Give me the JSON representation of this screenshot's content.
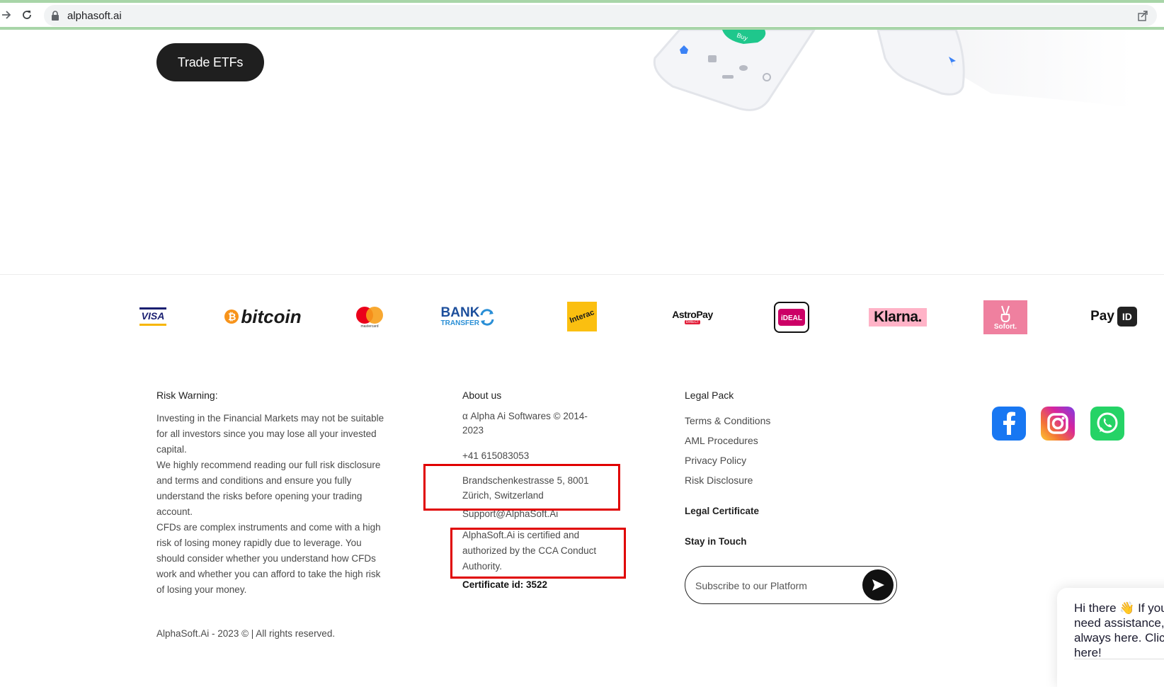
{
  "browser": {
    "url": "alphasoft.ai"
  },
  "hero": {
    "cta_label": "Trade ETFs",
    "phone_buy_label": "Buy"
  },
  "payments": [
    {
      "name": "visa-logo",
      "label": "VISA"
    },
    {
      "name": "bitcoin-logo",
      "label": "bitcoin"
    },
    {
      "name": "mastercard-logo",
      "label": "mastercard"
    },
    {
      "name": "bank-transfer-logo",
      "label": "BANK",
      "sub": "TRANSFER"
    },
    {
      "name": "interac-logo",
      "label": "Interac"
    },
    {
      "name": "astropay-logo",
      "label": "AstroPay",
      "sub": "DIRECT"
    },
    {
      "name": "ideal-logo",
      "label": "iDEAL"
    },
    {
      "name": "klarna-logo",
      "label": "Klarna."
    },
    {
      "name": "sofort-logo",
      "label": "Sofort."
    },
    {
      "name": "payid-logo",
      "label": "Pay",
      "sub": "ID"
    }
  ],
  "footer": {
    "risk": {
      "title": "Risk Warning:",
      "body": "Investing in the Financial Markets may not be suitable for all investors since you may lose all your invested capital.\nWe highly recommend reading our full risk disclosure and terms and conditions and ensure you fully understand the risks before opening your trading account.\nCFDs are complex instruments and come with a high risk of losing money rapidly due to leverage. You should consider whether you understand how CFDs work and whether you can afford to take the high risk of losing your money."
    },
    "copyright": "AlphaSoft.Ai - 2023 © | All rights reserved.",
    "about": {
      "title": "About us",
      "company": "α Alpha Ai Softwares © 2014-2023",
      "phone": "+41 615083053",
      "address": "Brandschenkestrasse 5, 8001 Zürich, Switzerland",
      "email": "Support@AlphaSoft.Ai",
      "certified": "AlphaSoft.Ai is certified and authorized by the CCA Conduct Authority.",
      "certificate": "Certificate id: 3522"
    },
    "legal": {
      "title": "Legal Pack",
      "links": [
        "Terms & Conditions",
        "AML Procedures",
        "Privacy Policy",
        "Risk Disclosure"
      ],
      "certificate_title": "Legal Certificate",
      "stay_title": "Stay in Touch",
      "subscribe_placeholder": "Subscribe to our Platform"
    },
    "social": [
      {
        "name": "facebook-icon",
        "color": "#1877f2"
      },
      {
        "name": "instagram-icon",
        "color": "#d6249f"
      },
      {
        "name": "whatsapp-icon",
        "color": "#25d366"
      }
    ]
  },
  "chat": {
    "text": "Hi there 👋 If you need assistance, I'm always here. Click here!"
  },
  "colors": {
    "highlight_box": "#e00000",
    "button_dark": "#1f1f1f"
  }
}
